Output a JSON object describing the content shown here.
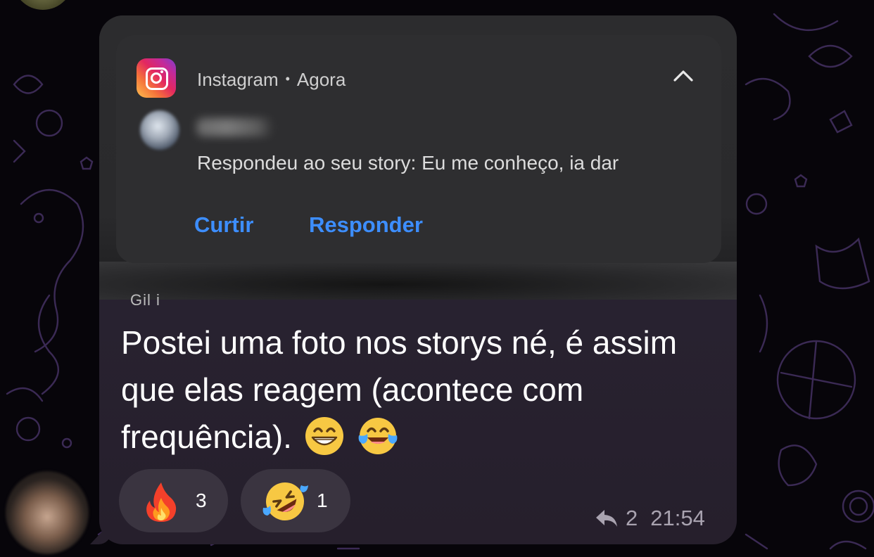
{
  "notification": {
    "app_name": "Instagram",
    "separator": "•",
    "time": "Agora",
    "sender_name": "",
    "body": "Respondeu ao seu story: Eu me conheço, ia dar",
    "actions": [
      "Curtir",
      "Responder"
    ]
  },
  "screenshot_footer_text": "Gil    i",
  "message": {
    "text": "Postei uma foto nos storys né, é assim que elas reagem (acontece com frequência).",
    "inline_emojis": [
      "grinning-face-with-smiling-eyes",
      "face-with-tears-of-joy"
    ]
  },
  "reactions": [
    {
      "emoji": "fire",
      "count": "3"
    },
    {
      "emoji": "rolling-on-the-floor-laughing",
      "count": "1"
    }
  ],
  "meta": {
    "replies": "2",
    "time": "21:54"
  },
  "colors": {
    "link_blue": "#3d8eff",
    "bubble": "#282230",
    "notification_bg": "#2e2e30",
    "meta_text": "#a9a3b0"
  }
}
